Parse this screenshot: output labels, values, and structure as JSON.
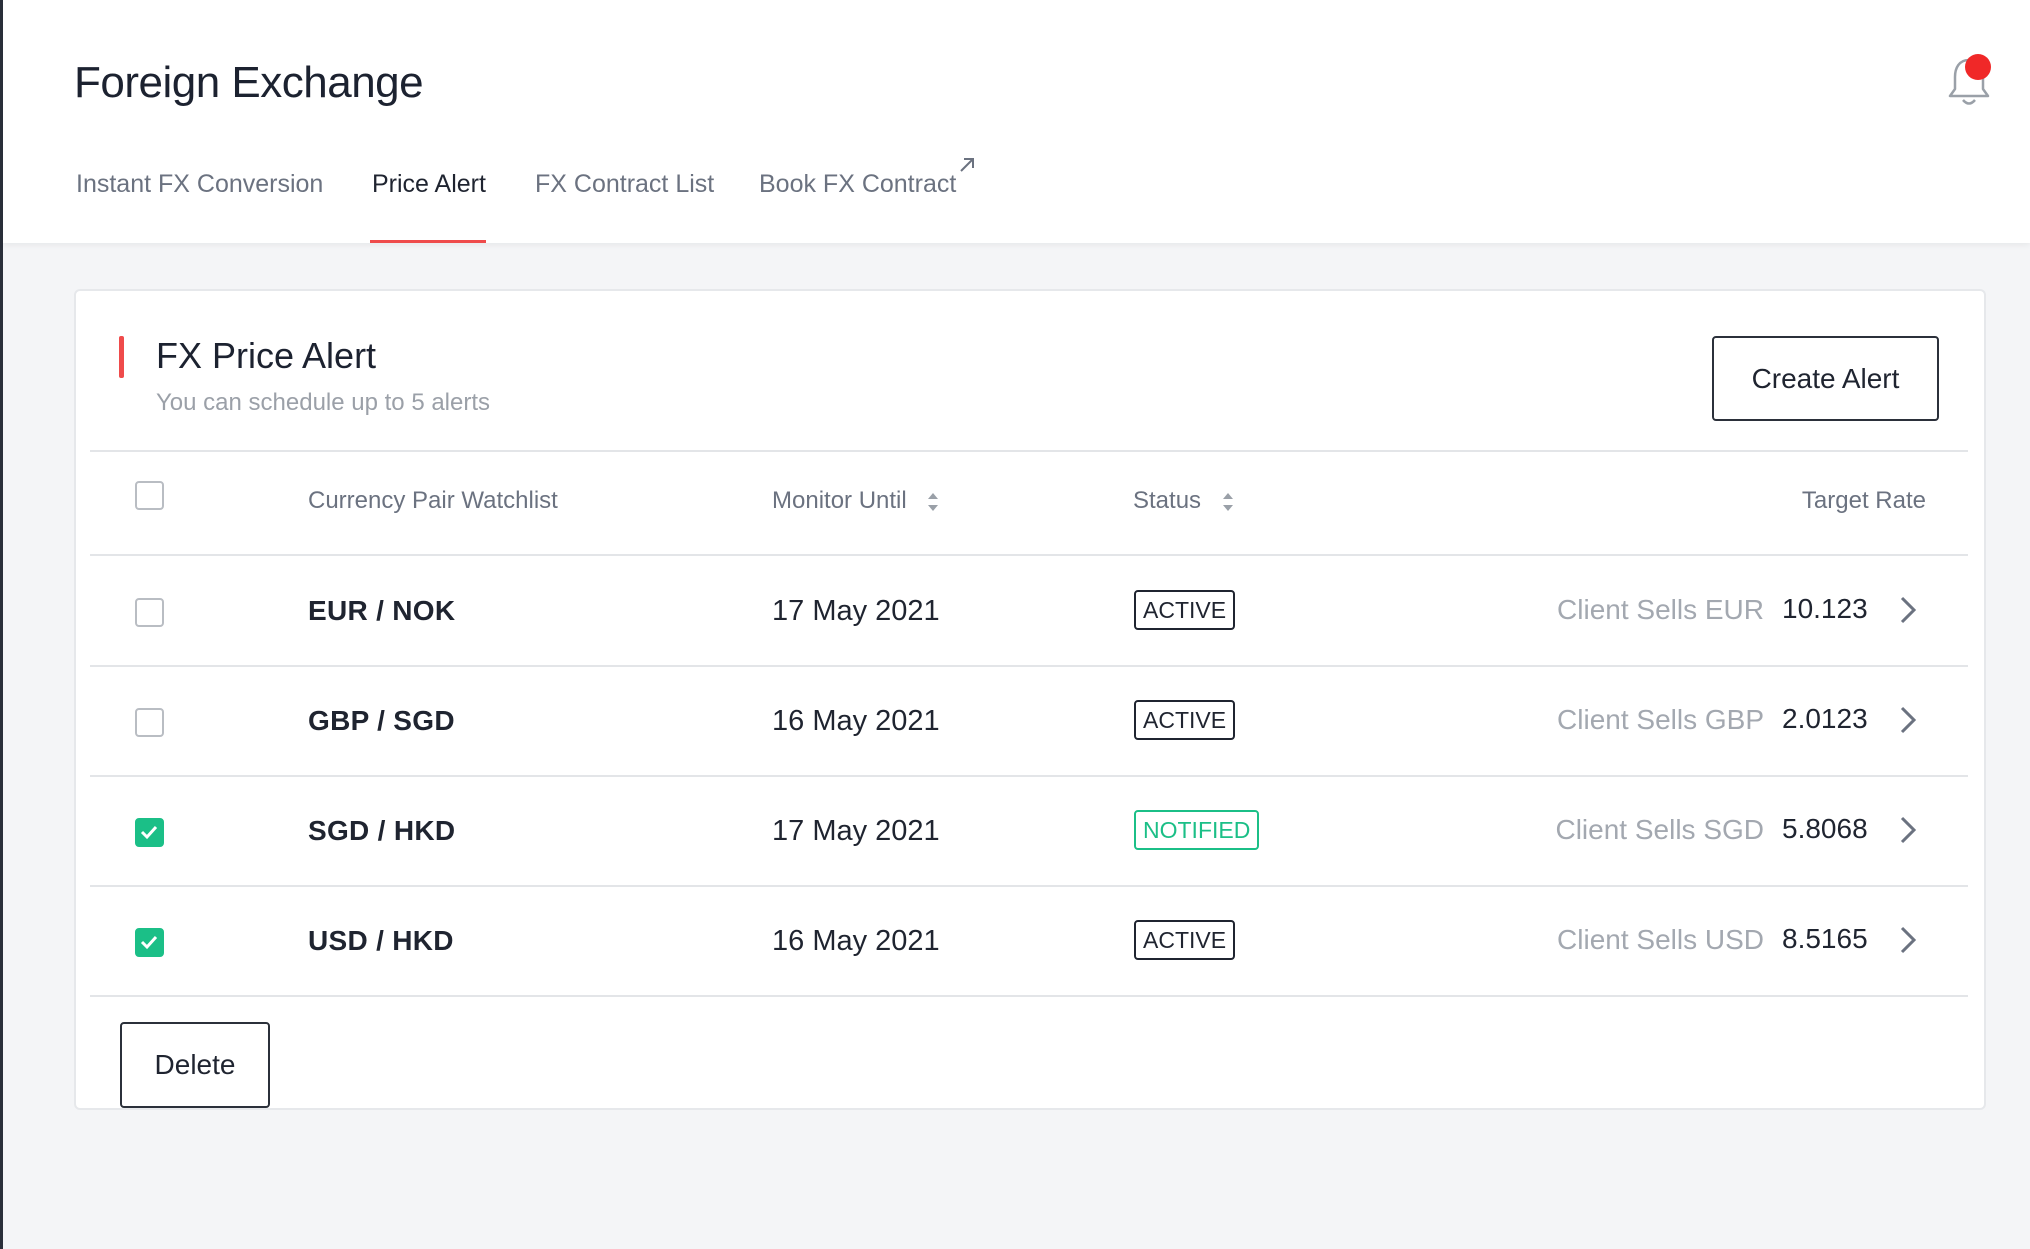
{
  "header": {
    "title": "Foreign Exchange",
    "tabs": [
      {
        "label": "Instant FX Conversion"
      },
      {
        "label": "Price Alert"
      },
      {
        "label": "FX Contract List"
      },
      {
        "label": "Book FX Contract"
      }
    ],
    "active_tab": "Price Alert",
    "accent_color": "#ef4b4b"
  },
  "card": {
    "title": "FX Price Alert",
    "subtitle": "You can schedule up to 5 alerts",
    "create_button": "Create Alert",
    "delete_button": "Delete"
  },
  "table": {
    "columns": {
      "pair": "Currency Pair Watchlist",
      "monitor_until": "Monitor Until",
      "status": "Status",
      "target_rate": "Target Rate"
    },
    "rows": [
      {
        "pair": "EUR / NOK",
        "monitor_until": "17 May 2021",
        "status": "ACTIVE",
        "side": "Client Sells EUR",
        "rate": "10.123",
        "checked": false
      },
      {
        "pair": "GBP / SGD",
        "monitor_until": "16 May 2021",
        "status": "ACTIVE",
        "side": "Client Sells GBP",
        "rate": "2.0123",
        "checked": false
      },
      {
        "pair": "SGD / HKD",
        "monitor_until": "17 May 2021",
        "status": "NOTIFIED",
        "side": "Client Sells SGD",
        "rate": "5.8068",
        "checked": true
      },
      {
        "pair": "USD / HKD",
        "monitor_until": "16 May 2021",
        "status": "ACTIVE",
        "side": "Client Sells USD",
        "rate": "8.5165",
        "checked": true
      }
    ],
    "header_checked": false,
    "check_color": "#1bbf87"
  }
}
